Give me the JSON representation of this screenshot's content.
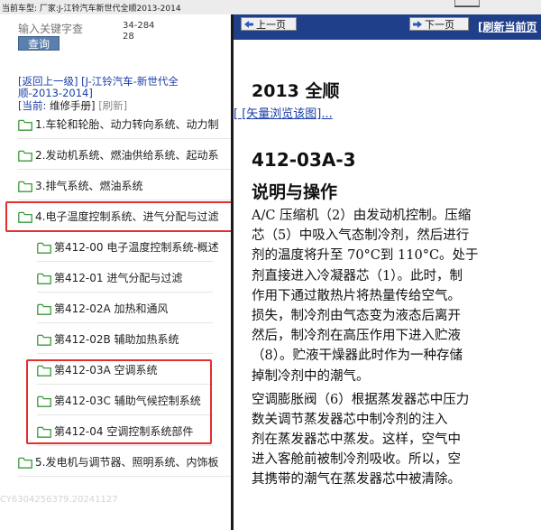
{
  "top_info": "当前车型: 厂家:J-江铃汽车新世代全顺2013-2014",
  "left": {
    "search_placeholder": "输入关键字查",
    "counter": "34-28428",
    "query_label": "查询",
    "crumbs": {
      "back": "[返回上一级]",
      "path": "[J-江铃汽车-新世代全顺-2013-2014]",
      "current_label": "[当前: ",
      "current_value": "维修手册]",
      "refresh": "[刷新]"
    },
    "tree": [
      {
        "label": "1.车轮和轮胎、动力转向系统、动力制",
        "level": 0
      },
      {
        "label": "2.发动机系统、燃油供给系统、起动系",
        "level": 0
      },
      {
        "label": "3.排气系统、燃油系统",
        "level": 0
      },
      {
        "label": "4.电子温度控制系统、进气分配与过滤",
        "level": 0
      },
      {
        "label": "第412-00 电子温度控制系统-概述",
        "level": 1
      },
      {
        "label": "第412-01 进气分配与过滤",
        "level": 1
      },
      {
        "label": "第412-02A 加热和通风",
        "level": 1
      },
      {
        "label": "第412-02B 辅助加热系统",
        "level": 1
      },
      {
        "label": "第412-03A 空调系统",
        "level": 1
      },
      {
        "label": "第412-03C 辅助气候控制系统",
        "level": 1
      },
      {
        "label": "第412-04 空调控制系统部件",
        "level": 1
      },
      {
        "label": "5.发电机与调节器、照明系统、内饰板",
        "level": 0
      }
    ],
    "watermark": "CY6304256379.20241127"
  },
  "right": {
    "prev_label": "上一页",
    "next_label": "下一页",
    "refresh_label": "[刷新当前页",
    "year_title": "2013 全顺",
    "vector_link": "[ [矢量浏览该图]...",
    "doc_number": "412-03A-3",
    "section_title": "说明与操作",
    "paragraph1": [
      "A/C 压缩机（2）由发动机控制。压缩",
      "芯（5）中吸入气态制冷剂，然后进行",
      "剂的温度将升至 70°C到 110°C。处于",
      "剂直接进入冷凝器芯（1）。此时，制",
      "作用下通过散热片将热量传给空气。",
      "损失，制冷剂由气态变为液态后离开",
      "然后，制冷剂在高压作用下进入贮液",
      "（8）。贮液干燥器此时作为一种存储",
      "掉制冷剂中的潮气。"
    ],
    "paragraph2": [
      "空调膨胀阀（6）根据蒸发器芯中压力",
      "数关调节蒸发器芯中制冷剂的注入",
      "剂在蒸发器芯中蒸发。这样，空气中",
      "进入客舱前被制冷剂吸收。所以，空",
      "其携带的潮气在蒸发器芯中被清除。"
    ]
  },
  "colors": {
    "nav_bar": "#1f3f8a",
    "link": "#1a3da8",
    "highlight": "#e03030",
    "folder": "#3a9a3a",
    "query_button": "#5b7fae"
  }
}
